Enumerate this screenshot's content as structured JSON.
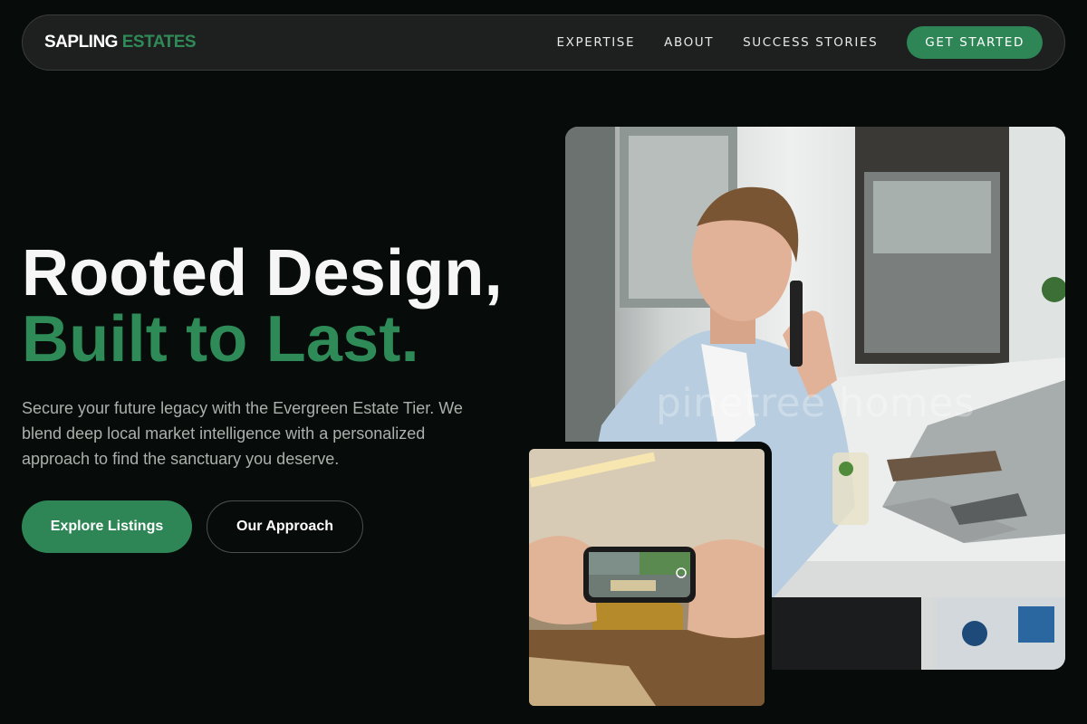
{
  "brand": {
    "word1": "SAPLING",
    "word2": "ESTATES"
  },
  "nav": {
    "links": [
      "EXPERTISE",
      "ABOUT",
      "SUCCESS STORIES"
    ],
    "cta": "GET STARTED"
  },
  "hero": {
    "headline_line1": "Rooted Design,",
    "headline_line2": "Built to Last.",
    "lead": "Secure your future legacy with the Evergreen Estate Tier. We blend deep local market intelligence with a personalized approach to find the sanctuary you deserve.",
    "primary_button": "Explore Listings",
    "secondary_button": "Our Approach"
  },
  "images": {
    "main_alt": "Man in light blue blazer on the phone at a marble cafe counter with a laptop",
    "main_watermark": "pinetree homes",
    "inset_alt": "Hands holding a smartphone photographing a warmly lit living room"
  },
  "colors": {
    "background": "#070b09",
    "nav_bg": "#1e201f",
    "accent_green": "#2e8656",
    "text_muted": "#aab1ad"
  }
}
